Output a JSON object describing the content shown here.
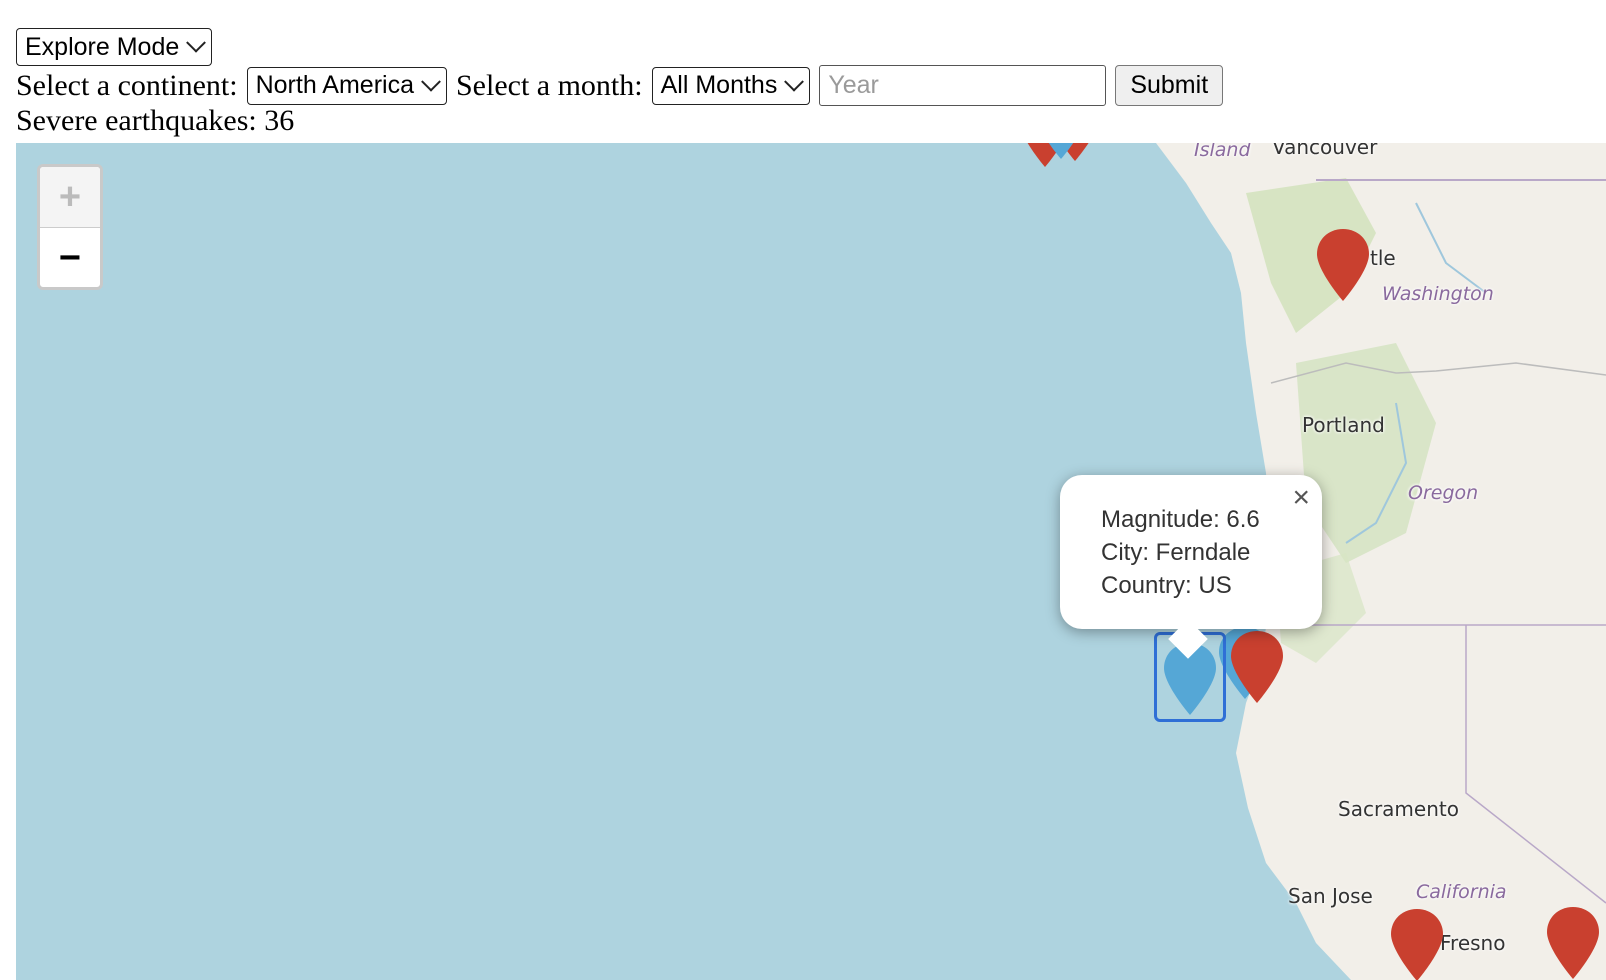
{
  "controls": {
    "mode_select": "Explore Mode",
    "continent_label": "Select a continent:",
    "continent_value": "North America",
    "month_label": "Select a month:",
    "month_value": "All Months",
    "year_placeholder": "Year",
    "submit_label": "Submit"
  },
  "summary": {
    "label": "Severe earthquakes:",
    "count": "36"
  },
  "map": {
    "zoom_in": "+",
    "zoom_out": "−",
    "places": {
      "island": "Island",
      "vancouver": "Vancouver",
      "seattle": "tle",
      "washington": "Washington",
      "portland": "Portland",
      "oregon": "Oregon",
      "sacramento": "Sacramento",
      "san_jose": "San Jose",
      "california": "California",
      "fresno": "Fresno"
    },
    "popup": {
      "magnitude": "Magnitude: 6.6",
      "city": "City: Ferndale",
      "country": "Country: US",
      "close": "×"
    },
    "colors": {
      "water": "#aed3df",
      "land": "#f2efe9",
      "marker_red": "#c9402f",
      "marker_blue": "#55a7d6"
    }
  }
}
